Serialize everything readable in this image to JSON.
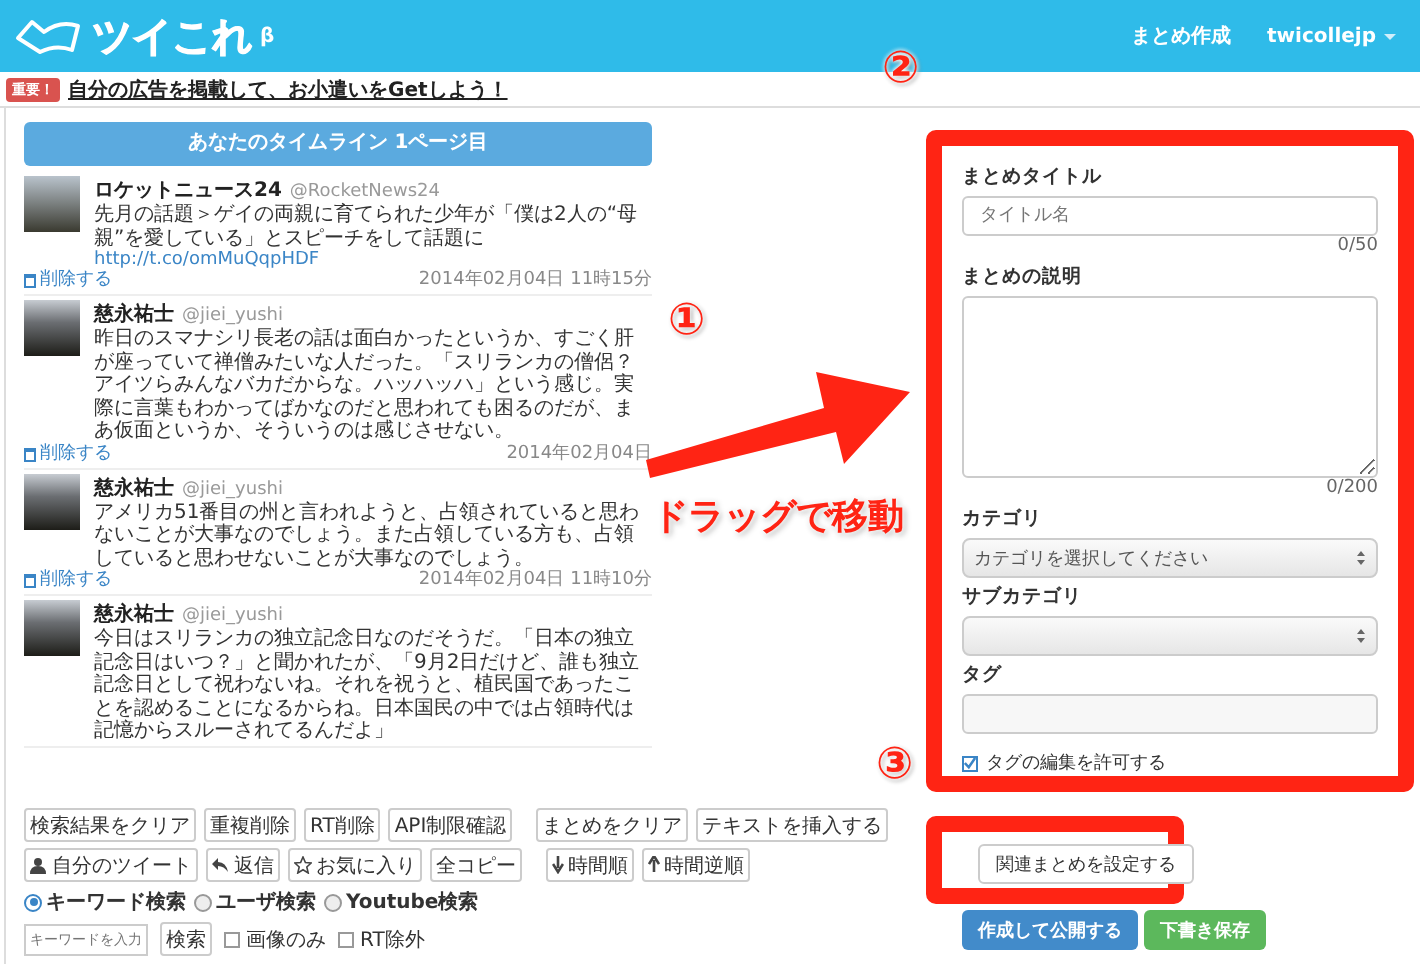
{
  "header": {
    "logo": {
      "text": "ツイこれ",
      "badge": "β"
    },
    "nav": [
      {
        "label": "まとめ作成",
        "dropdown": false
      },
      {
        "label": "twicollejp",
        "dropdown": true
      }
    ]
  },
  "notice": {
    "badge": "重要！",
    "link": "自分の広告を掲載して、お小遣いをGetしよう！"
  },
  "timeline": {
    "title": "あなたのタイムライン 1ページ目",
    "tweets": [
      {
        "name": "ロケットニュース24",
        "handle": "@RocketNews24",
        "text": "先月の話題＞ゲイの両親に育てられた少年が「僕は2人の“母親”を愛している」とスピーチをして話題に",
        "link": "http://t.co/omMuQqpHDF",
        "date": "2014年02月04日 11時15分",
        "delete": "削除する"
      },
      {
        "name": "慈永祐士",
        "handle": "@jiei_yushi",
        "text": "昨日のスマナシリ長老の話は面白かったというか、すごく肝が座っていて禅僧みたいな人だった。「スリランカの僧侶？アイツらみんなバカだからな。ハッハッハ」という感じ。実際に言葉もわかってばかなのだと思われても困るのだが、まあ仮面というか、そういうのは感じさせない。",
        "date": "2014年02月04日",
        "delete": "削除する"
      },
      {
        "name": "慈永祐士",
        "handle": "@jiei_yushi",
        "text": "アメリカ51番目の州と言われようと、占領されていると思わないことが大事なのでしょう。また占領している方も、占領していると思わせないことが大事なのでしょう。",
        "date": "2014年02月04日 11時10分",
        "delete": "削除する"
      },
      {
        "name": "慈永祐士",
        "handle": "@jiei_yushi",
        "text": "今日はスリランカの独立記念日なのだそうだ。「日本の独立記念日はいつ？」と聞かれたが、「9月2日だけど、誰も独立記念日として祝わないね。それを祝うと、植民国であったことを認めることになるからね。日本国民の中では占領時代は記憶からスルーされてるんだよ」"
      }
    ]
  },
  "toolbar": [
    {
      "groups": [
        [
          {
            "label": "検索結果をクリア"
          },
          {
            "label": "重複削除"
          },
          {
            "label": "RT削除"
          },
          {
            "label": "API制限確認"
          }
        ],
        [
          {
            "label": "まとめをクリア"
          },
          {
            "label": "テキストを挿入する"
          }
        ]
      ]
    },
    {
      "groups": [
        [
          {
            "label": "自分のツイート",
            "kind": "person"
          },
          {
            "label": "返信",
            "kind": "reply"
          },
          {
            "label": "お気に入り",
            "kind": "star"
          },
          {
            "label": "全コピー"
          }
        ],
        [
          {
            "label": "時間順",
            "kind": "down"
          },
          {
            "label": "時間逆順",
            "kind": "up"
          }
        ]
      ]
    }
  ],
  "search": {
    "modes": [
      {
        "label": "キーワード検索",
        "selected": true
      },
      {
        "label": "ユーザ検索",
        "selected": false
      },
      {
        "label": "Youtube検索",
        "selected": false
      }
    ],
    "keyword": {
      "placeholder": "キーワードを入力"
    },
    "button": "検索",
    "filters": [
      {
        "label": "画像のみ",
        "checked": false
      },
      {
        "label": "RT除外",
        "checked": false
      }
    ]
  },
  "form": {
    "fields": [
      {
        "kind": "text",
        "label": "まとめタイトル",
        "placeholder": "タイトル名",
        "counter": "0/50"
      },
      {
        "kind": "textarea",
        "label": "まとめの説明",
        "counter": "0/200"
      },
      {
        "kind": "select",
        "label": "カテゴリ",
        "value": "カテゴリを選択してください"
      },
      {
        "kind": "select",
        "label": "サブカテゴリ"
      },
      {
        "kind": "text",
        "label": "タグ"
      }
    ],
    "allow_tag_edit": {
      "label": "タグの編集を許可する",
      "checked": true
    }
  },
  "related_button": "関連まとめを設定する",
  "actions": [
    {
      "label": "作成して公開する",
      "kind": "primary"
    },
    {
      "label": "下書き保存",
      "kind": "success"
    }
  ],
  "annotations": {
    "markers": [
      {
        "label": "①"
      },
      {
        "label": "②"
      },
      {
        "label": "③"
      }
    ],
    "caption": "ドラッグで移動"
  }
}
